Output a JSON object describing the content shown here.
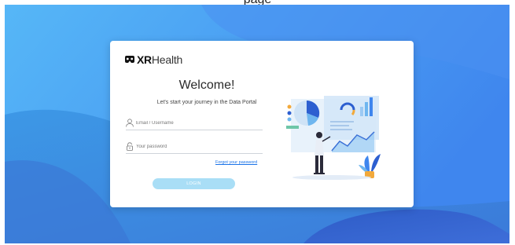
{
  "page_caption": "page",
  "brand": {
    "logo_bold": "XR",
    "logo_regular": "Health"
  },
  "login": {
    "title": "Welcome!",
    "subtitle": "Let's start your journey in the Data Portal",
    "email_placeholder": "Email / Username",
    "password_placeholder": "Your password",
    "forgot_label": "Forgot your password",
    "login_label": "LOGIN"
  },
  "colors": {
    "bg_light": "#4aa7f0",
    "bg_dark": "#3a5fd8",
    "button": "#a9def6",
    "link": "#1a73e8"
  }
}
